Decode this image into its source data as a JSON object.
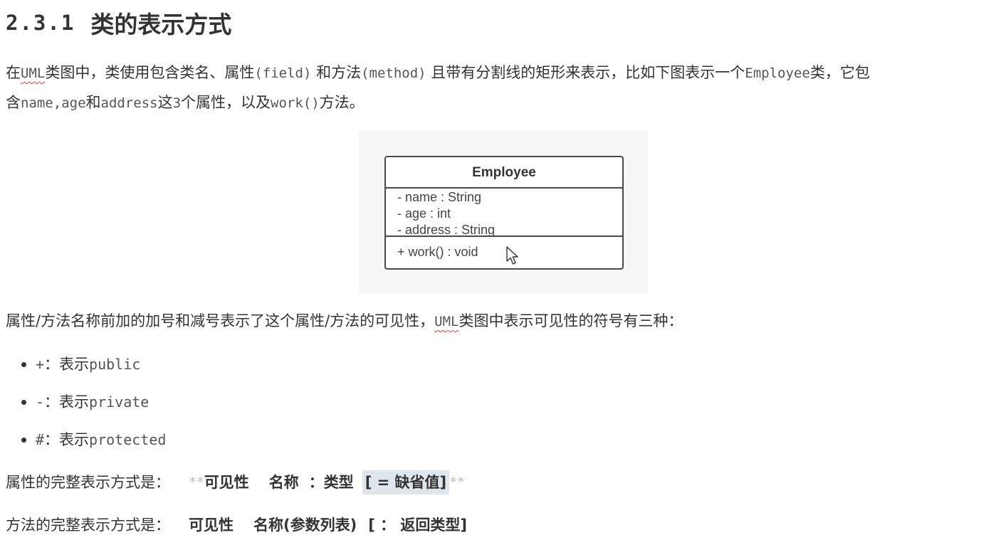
{
  "heading": {
    "number": "2.3.1",
    "title": "类的表示方式"
  },
  "intro": {
    "t1": "在",
    "uml": "UML",
    "t2": "类图中，类使用包含类名、属性",
    "field": "(field)",
    "t3": " 和方法",
    "method": "(method)",
    "t4": " 且带有分割线的矩形来表示，比如下图表示一个",
    "employee": "Employee",
    "t5": "类，它包",
    "t6": "含",
    "name": "name,age",
    "t7": "和",
    "address": "address",
    "t8": "这",
    "three": "3",
    "t9": "个属性，以及",
    "work": "work()",
    "t10": "方法。"
  },
  "uml_class": {
    "name": "Employee",
    "attributes": [
      "- name : String",
      "- age : int",
      "- address : String"
    ],
    "methods": [
      "+ work() : void"
    ]
  },
  "visibility_intro": {
    "t1": "属性/方法名称前加的加号和减号表示了这个属性/方法的可见性，",
    "uml": "UML",
    "t2": "类图中表示可见性的符号有三种："
  },
  "visibility_items": [
    {
      "symbol": "+",
      "label": "：表示",
      "value": "public"
    },
    {
      "symbol": "-",
      "label": "：表示",
      "value": "private"
    },
    {
      "symbol": "#",
      "label": "：表示",
      "value": "protected"
    }
  ],
  "attr_format": {
    "label": "属性的完整表示方式是：",
    "stars_open": "**",
    "visibility": "可见性",
    "name": "名称",
    "colon": "：",
    "type": "类型",
    "default": "[ = 缺省值]",
    "stars_close": "**"
  },
  "method_format": {
    "label": "方法的完整表示方式是：",
    "visibility": "可见性",
    "name": "名称(参数列表)",
    "ret": "[ ： 返回类型]"
  }
}
